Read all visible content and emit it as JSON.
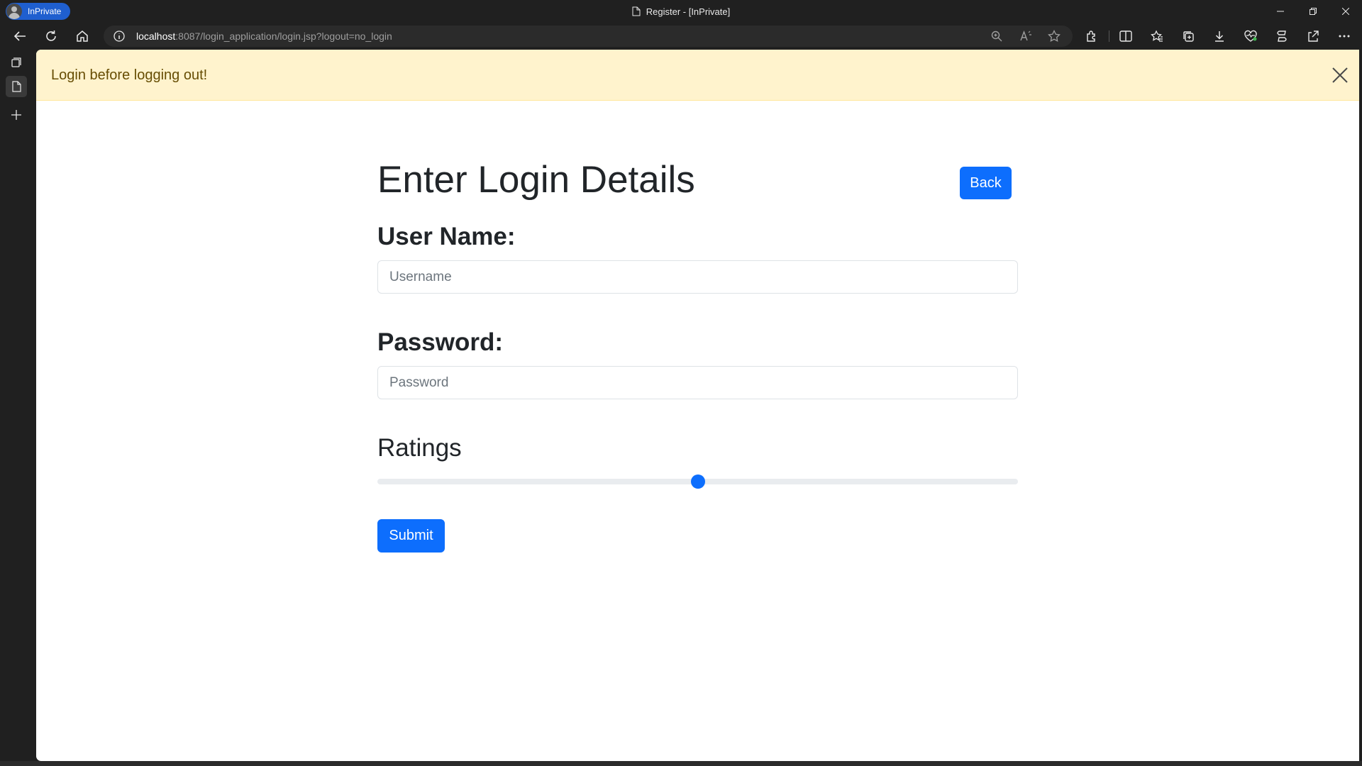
{
  "browser": {
    "profile_label": "InPrivate",
    "window_title": "Register - [InPrivate]",
    "url_host": "localhost",
    "url_path": ":8087/login_application/login.jsp?logout=no_login"
  },
  "alert": {
    "message": "Login before logging out!"
  },
  "form": {
    "heading": "Enter Login Details",
    "back_label": "Back",
    "username_label": "User Name:",
    "username_placeholder": "Username",
    "username_value": "",
    "password_label": "Password:",
    "password_placeholder": "Password",
    "password_value": "",
    "ratings_label": "Ratings",
    "ratings_level": 0.5,
    "submit_label": "Submit"
  },
  "colors": {
    "primary": "#0d6efd",
    "alert_bg": "#fff3cd",
    "alert_text": "#664d03",
    "browser_chrome": "#202020"
  },
  "icons": {
    "toolbar": [
      "back-arrow-icon",
      "refresh-icon",
      "home-icon",
      "info-icon",
      "zoom-icon",
      "read-aloud-icon",
      "favorite-star-icon",
      "extensions-icon",
      "split-screen-icon",
      "favorites-icon",
      "collections-icon",
      "downloads-icon",
      "browser-essentials-icon",
      "copilot-icon",
      "share-icon",
      "more-icon"
    ],
    "sidebar": [
      "tab-actions-icon",
      "page-tab-icon",
      "new-tab-icon"
    ],
    "window": [
      "minimize-icon",
      "restore-icon",
      "close-window-icon"
    ],
    "alert": "close-icon"
  }
}
